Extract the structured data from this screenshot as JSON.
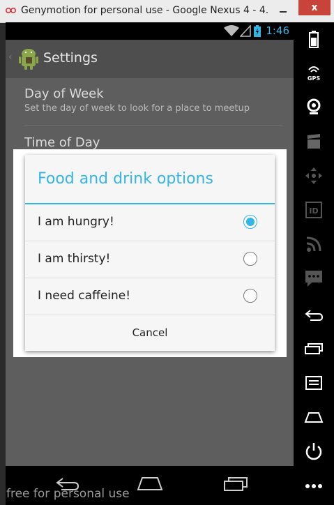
{
  "window": {
    "title": "Genymotion for personal use - Google Nexus 4 - 4...",
    "close_glyph": "x"
  },
  "statusbar": {
    "clock": "1:46"
  },
  "actionbar": {
    "title": "Settings"
  },
  "preferences": [
    {
      "title": "Day of Week",
      "summary": "Set the day of week to look for a place to meetup"
    },
    {
      "title": "Time of Day",
      "summary": ""
    }
  ],
  "dialog": {
    "title": "Food and drink options",
    "options": [
      {
        "label": "I am hungry!",
        "selected": true
      },
      {
        "label": "I am thirsty!",
        "selected": false
      },
      {
        "label": "I need caffeine!",
        "selected": false
      }
    ],
    "cancel_label": "Cancel"
  },
  "watermark": "free for personal use",
  "sidepanel": {
    "items": [
      "battery-icon",
      "gps-icon",
      "camera-icon",
      "video-icon",
      "dpad-icon",
      "id-icon",
      "broadcast-icon",
      "sms-icon",
      "back-icon",
      "recent-apps-icon",
      "menu-icon",
      "home-icon",
      "power-icon",
      "more-icon"
    ],
    "gps_label": "GPS",
    "id_label": "ID"
  },
  "colors": {
    "accent": "#33b5e5",
    "dim_screen": "#5e5e5e"
  }
}
